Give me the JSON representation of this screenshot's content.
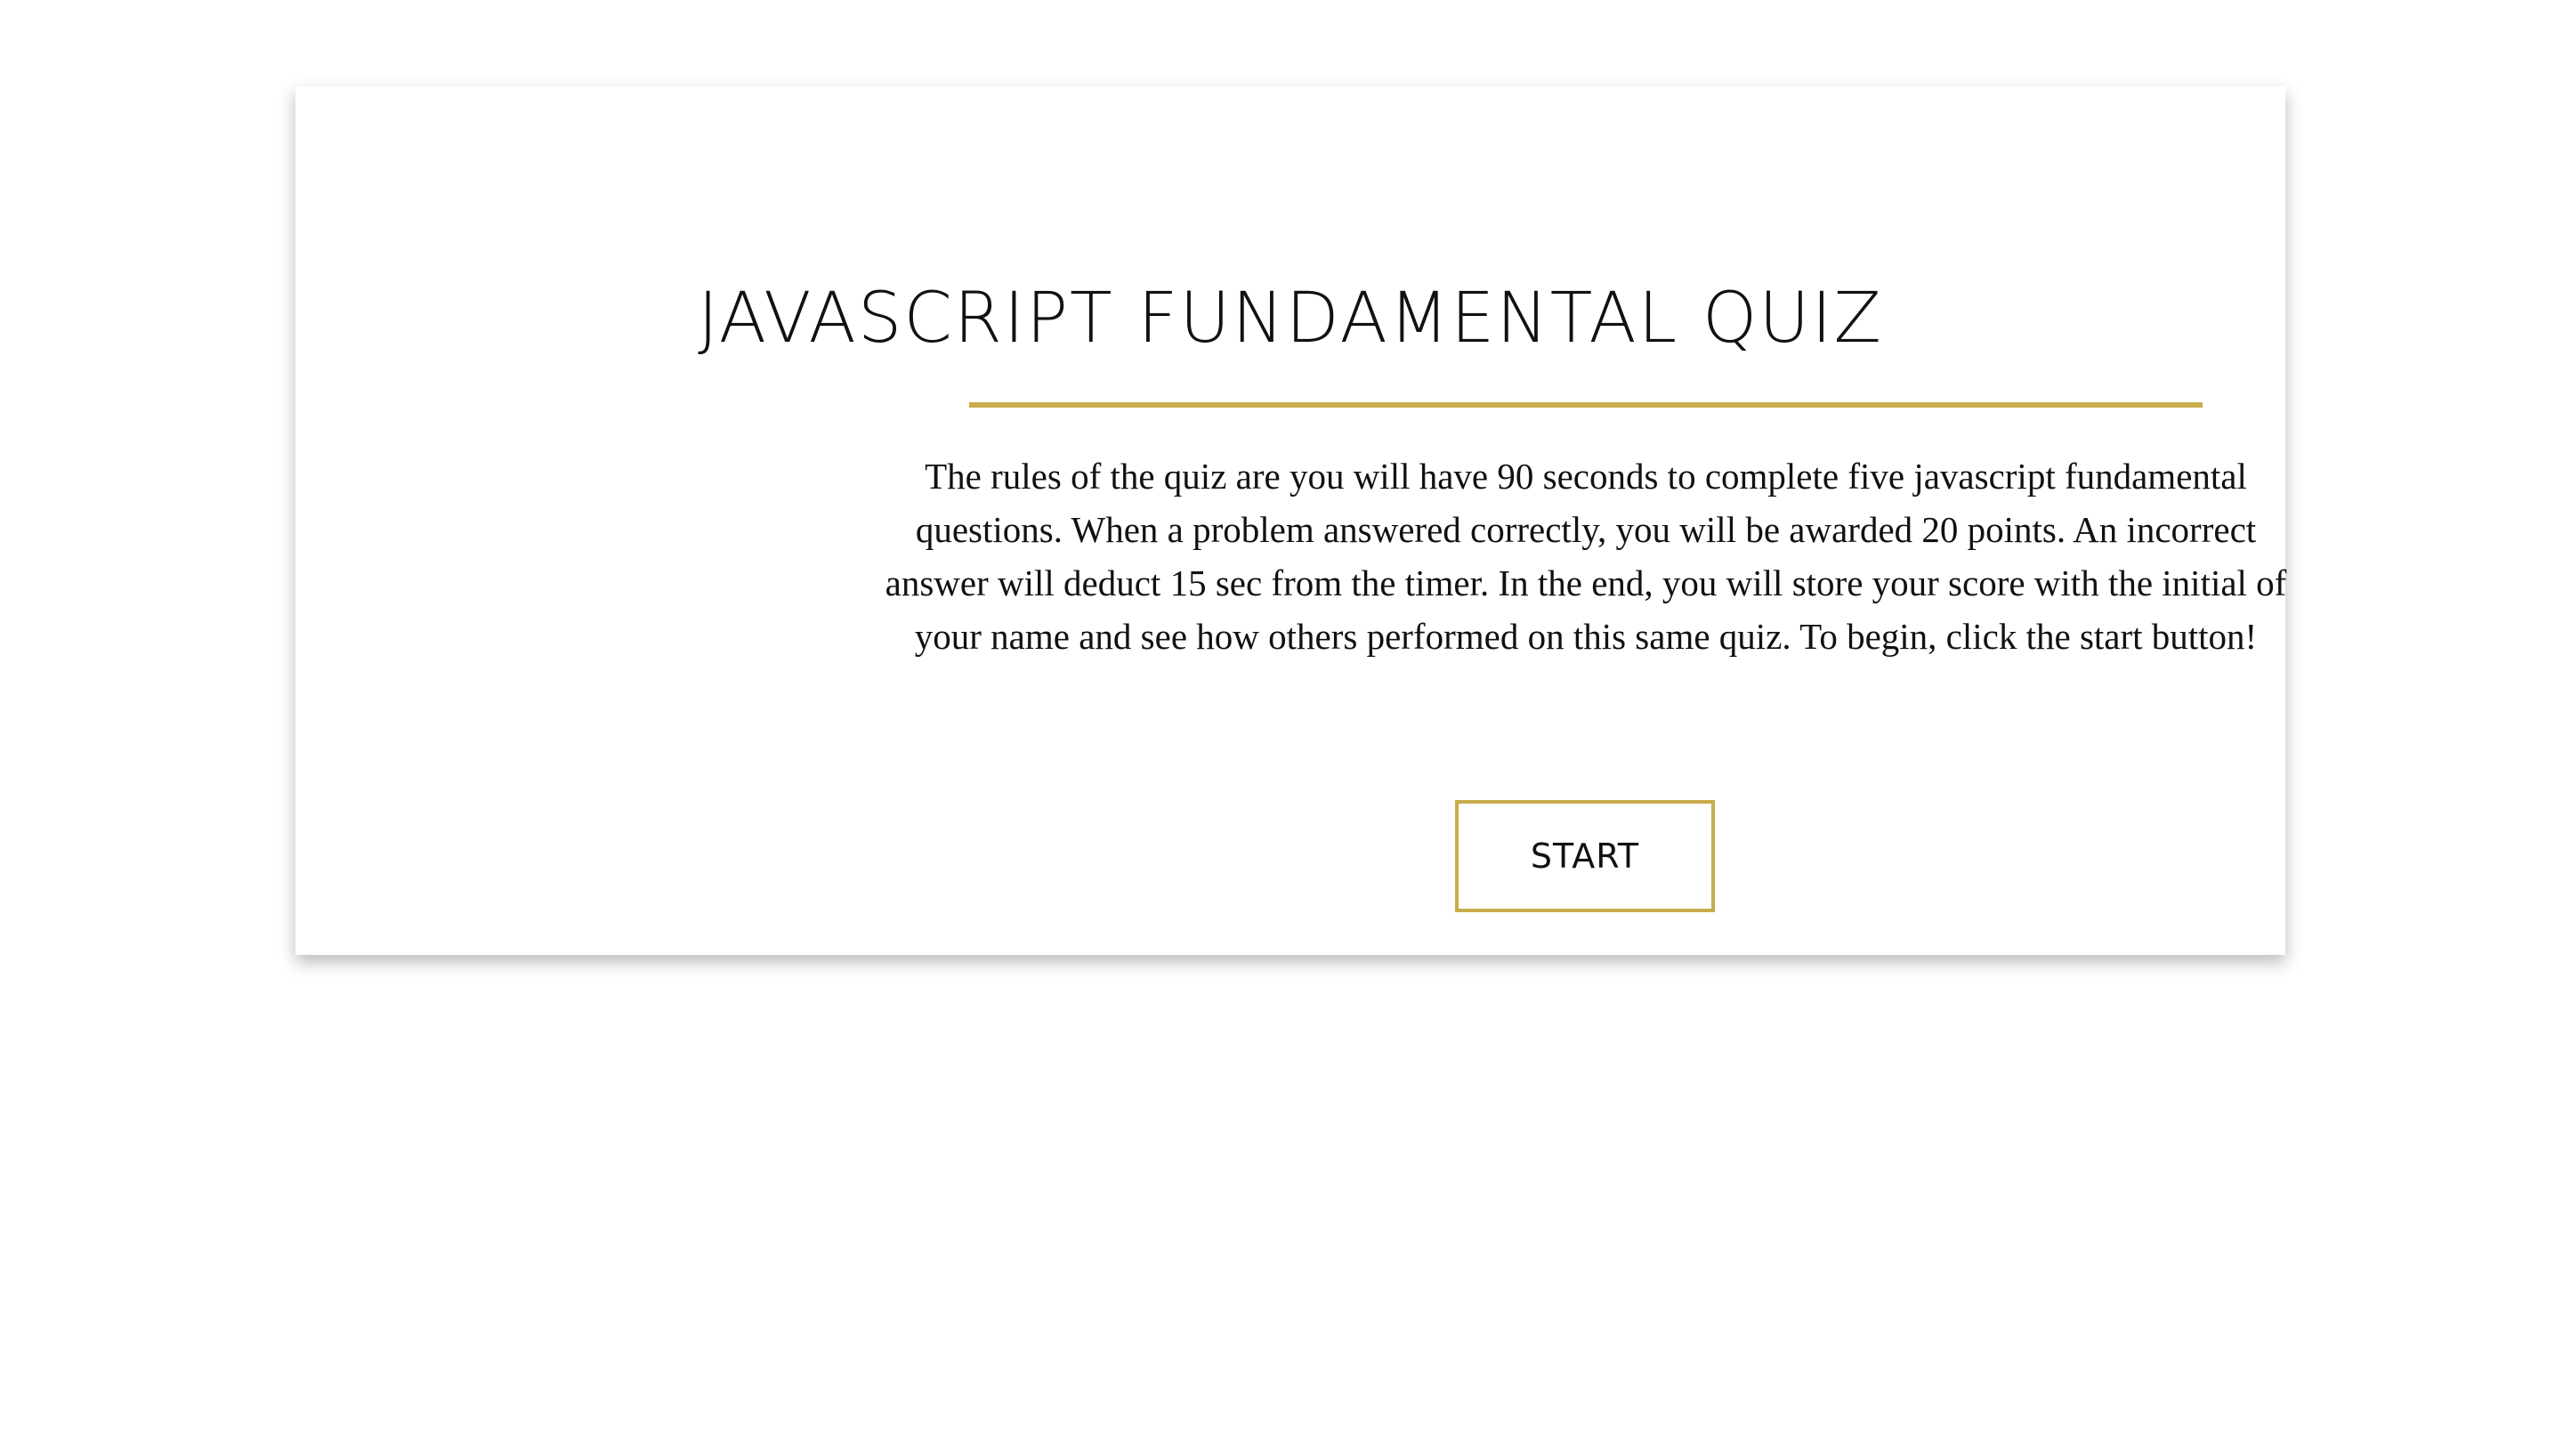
{
  "quiz": {
    "title": "JAVASCRIPT FUNDAMENTAL QUIZ",
    "rules": "The rules of the quiz are you will have 90 seconds to complete five javascript fundamental questions. When a problem answered correctly, you will be awarded 20 points. An incorrect answer will deduct 15 sec from the timer. In the end, you will store your score with the initial of your name and see how others performed on this same quiz. To begin, click the start button!",
    "start_label": "START"
  },
  "colors": {
    "accent": "#c9ac4c",
    "text": "#111111",
    "background": "#ffffff"
  }
}
